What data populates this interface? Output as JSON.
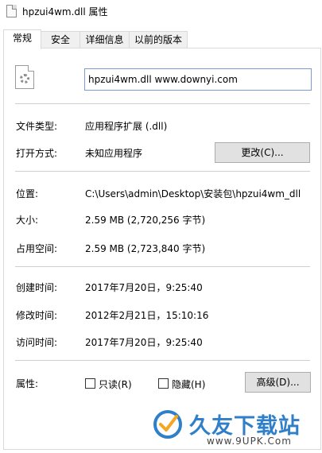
{
  "window": {
    "title": "hpzui4wm.dll 属性"
  },
  "tabs": [
    {
      "label": "常规",
      "active": true
    },
    {
      "label": "安全",
      "active": false
    },
    {
      "label": "详细信息",
      "active": false
    },
    {
      "label": "以前的版本",
      "active": false
    }
  ],
  "file": {
    "icon": "dll-file-gear-icon",
    "name_value": "hpzui4wm.dll www.downyi.com"
  },
  "type_section": {
    "file_type_label": "文件类型:",
    "file_type_value": "应用程序扩展 (.dll)",
    "opens_with_label": "打开方式:",
    "opens_with_value": "未知应用程序",
    "change_button": "更改(C)..."
  },
  "location_section": {
    "location_label": "位置:",
    "location_value": "C:\\Users\\admin\\Desktop\\安装包\\hpzui4wm_dll",
    "size_label": "大小:",
    "size_value": "2.59 MB (2,720,256 字节)",
    "size_on_disk_label": "占用空间:",
    "size_on_disk_value": "2.59 MB (2,723,840 字节)"
  },
  "dates_section": {
    "created_label": "创建时间:",
    "created_value": "2017年7月20日，9:25:40",
    "modified_label": "修改时间:",
    "modified_value": "2012年2月21日，15:10:16",
    "accessed_label": "访问时间:",
    "accessed_value": "2017年7月20日，9:25:40"
  },
  "attributes_section": {
    "label": "属性:",
    "readonly_label": "只读(R)",
    "readonly_checked": false,
    "hidden_label": "隐藏(H)",
    "hidden_checked": false,
    "advanced_button": "高级(D)..."
  },
  "watermark": {
    "brand": "久友下载站",
    "url": "www.9UPK.Com"
  },
  "colors": {
    "focus_border": "#7a9cd3",
    "button_bg": "#e1e1e1",
    "watermark_blue": "#2f7fc9"
  }
}
